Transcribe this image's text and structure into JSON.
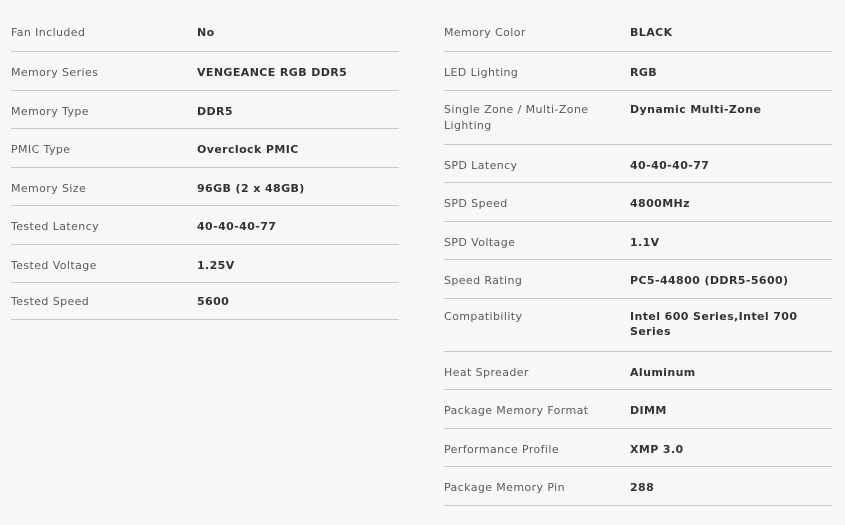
{
  "specs_left": [
    {
      "label": "Fan Included",
      "value": "No"
    },
    {
      "label": "Memory Series",
      "value": "VENGEANCE RGB DDR5"
    },
    {
      "label": "Memory Type",
      "value": "DDR5"
    },
    {
      "label": "PMIC Type",
      "value": "Overclock PMIC"
    },
    {
      "label": "Memory Size",
      "value": "96GB (2 x 48GB)"
    },
    {
      "label": "Tested Latency",
      "value": "40-40-40-77"
    },
    {
      "label": "Tested Voltage",
      "value": "1.25V"
    },
    {
      "label": "Tested Speed",
      "value": "5600"
    }
  ],
  "specs_right": [
    {
      "label": "Memory Color",
      "value": "BLACK"
    },
    {
      "label": "LED Lighting",
      "value": "RGB"
    },
    {
      "label": "Single Zone / Multi-Zone Lighting",
      "value": "Dynamic Multi-Zone"
    },
    {
      "label": "SPD Latency",
      "value": "40-40-40-77"
    },
    {
      "label": "SPD Speed",
      "value": "4800MHz"
    },
    {
      "label": "SPD Voltage",
      "value": "1.1V"
    },
    {
      "label": "Speed Rating",
      "value": "PC5-44800 (DDR5-5600)"
    },
    {
      "label": "Compatibility",
      "value": "Intel 600 Series,Intel 700 Series"
    },
    {
      "label": "Heat Spreader",
      "value": "Aluminum"
    },
    {
      "label": "Package Memory Format",
      "value": "DIMM"
    },
    {
      "label": "Performance Profile",
      "value": "XMP 3.0"
    },
    {
      "label": "Package Memory Pin",
      "value": "288"
    }
  ]
}
